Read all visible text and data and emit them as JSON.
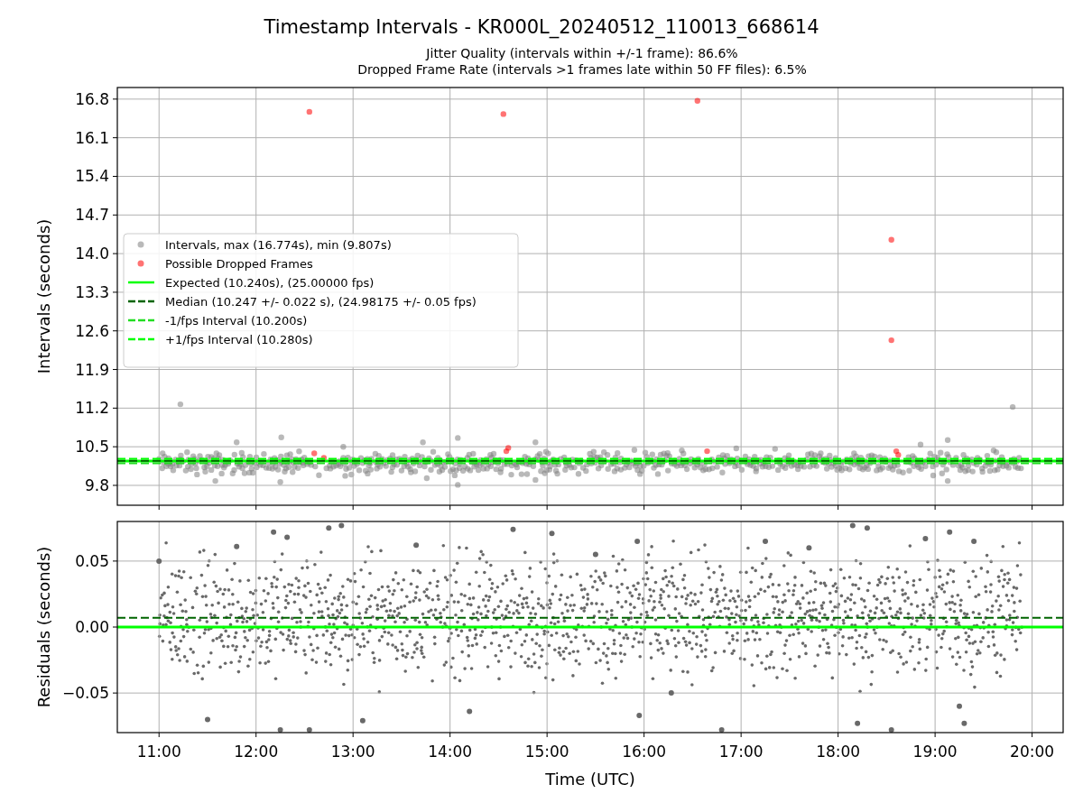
{
  "figure": {
    "title": "Timestamp Intervals - KR000L_20240512_110013_668614",
    "subtitle_lines": [
      "Jitter Quality (intervals within +/-1 frame): 86.6%",
      "Dropped Frame Rate (intervals >1 frames late within 50 FF files): 6.5%"
    ]
  },
  "intervals_panel": {
    "chart_data": {
      "type": "scatter",
      "ylabel": "Intervals (seconds)",
      "xlim": [
        10.57,
        20.32
      ],
      "ylim": [
        9.44,
        17.01
      ],
      "grid": true,
      "legend": "center left",
      "yticks": [
        {
          "value": 9.8,
          "label": "9.8"
        },
        {
          "value": 10.5,
          "label": "10.5"
        },
        {
          "value": 11.2,
          "label": "11.2"
        },
        {
          "value": 11.9,
          "label": "11.9"
        },
        {
          "value": 12.6,
          "label": "12.6"
        },
        {
          "value": 13.3,
          "label": "13.3"
        },
        {
          "value": 14.0,
          "label": "14.0"
        },
        {
          "value": 14.7,
          "label": "14.7"
        },
        {
          "value": 15.4,
          "label": "15.4"
        },
        {
          "value": 16.1,
          "label": "16.1"
        },
        {
          "value": 16.8,
          "label": "16.8"
        }
      ],
      "series": [
        {
          "name": "Intervals, max (16.774s), min (9.807s)",
          "color": "#808080",
          "x": [
            11.22,
            19.8,
            14.08,
            12.25,
            11.58,
            14.88,
            13.76,
            18.98,
            19.13,
            12.26,
            14.08,
            19.13,
            11.8,
            13.72,
            14.88,
            16.95,
            18.85,
            12.9,
            15.9,
            17.35
          ],
          "values": [
            11.27,
            11.22,
            9.81,
            9.86,
            9.88,
            9.9,
            9.93,
            9.98,
            9.88,
            10.67,
            10.66,
            10.62,
            10.58,
            10.58,
            10.58,
            10.47,
            10.54,
            10.5,
            10.44,
            10.46
          ]
        },
        {
          "name": "Possible Dropped Frames",
          "color": "#ff0000",
          "x": [
            12.55,
            14.55,
            16.55,
            18.55,
            18.55,
            12.6,
            12.7,
            14.6,
            14.58,
            16.65,
            18.6,
            18.62
          ],
          "values": [
            16.57,
            16.53,
            16.77,
            14.25,
            12.43,
            10.38,
            10.3,
            10.48,
            10.42,
            10.42,
            10.42,
            10.35
          ]
        }
      ],
      "ref_lines": [
        {
          "axis": "y",
          "value": 10.24,
          "label": "Expected (10.240s), (25.00000 fps)"
        },
        {
          "axis": "y",
          "value": 10.247,
          "label": "Median (10.247 +/- 0.022 s), (24.98175 +/- 0.05 fps)"
        },
        {
          "axis": "y",
          "value": 10.2,
          "label": "-1/fps Interval (10.200s)"
        },
        {
          "axis": "y",
          "value": 10.28,
          "label": "+1/fps Interval (10.280s)"
        }
      ]
    }
  },
  "residuals_panel": {
    "chart_data": {
      "type": "scatter",
      "xlabel": "Time (UTC)",
      "ylabel": "Residuals (seconds)",
      "xlim": [
        10.57,
        20.32
      ],
      "ylim": [
        -0.08,
        0.08
      ],
      "grid": true,
      "xticks": [
        {
          "value": 11,
          "label": "11:00"
        },
        {
          "value": 12,
          "label": "12:00"
        },
        {
          "value": 13,
          "label": "13:00"
        },
        {
          "value": 14,
          "label": "14:00"
        },
        {
          "value": 15,
          "label": "15:00"
        },
        {
          "value": 16,
          "label": "16:00"
        },
        {
          "value": 17,
          "label": "17:00"
        },
        {
          "value": 18,
          "label": "18:00"
        },
        {
          "value": 19,
          "label": "19:00"
        },
        {
          "value": 20,
          "label": "20:00"
        }
      ],
      "yticks": [
        {
          "value": -0.05,
          "label": "−0.05"
        },
        {
          "value": 0,
          "label": "0.00"
        },
        {
          "value": 0.05,
          "label": "0.05"
        }
      ],
      "series": [
        {
          "color": "#696969",
          "x": [
            11.0,
            11.5,
            11.8,
            12.18,
            12.25,
            12.32,
            12.55,
            12.75,
            12.88,
            13.1,
            13.65,
            14.2,
            14.65,
            15.05,
            15.5,
            15.93,
            15.95,
            16.28,
            16.8,
            17.25,
            17.7,
            18.15,
            18.2,
            18.3,
            18.55,
            18.9,
            19.15,
            19.3,
            19.4,
            19.25
          ],
          "values": [
            0.05,
            -0.07,
            0.061,
            0.072,
            -0.078,
            0.068,
            -0.078,
            0.075,
            0.077,
            -0.071,
            0.062,
            -0.064,
            0.074,
            0.071,
            0.055,
            0.065,
            -0.067,
            -0.05,
            -0.078,
            0.065,
            0.06,
            0.077,
            -0.073,
            0.075,
            -0.078,
            0.067,
            0.072,
            -0.073,
            0.065,
            -0.06
          ]
        }
      ],
      "ref_lines": [
        {
          "axis": "y",
          "value": 0
        },
        {
          "axis": "y",
          "value": 0.007
        }
      ]
    }
  }
}
